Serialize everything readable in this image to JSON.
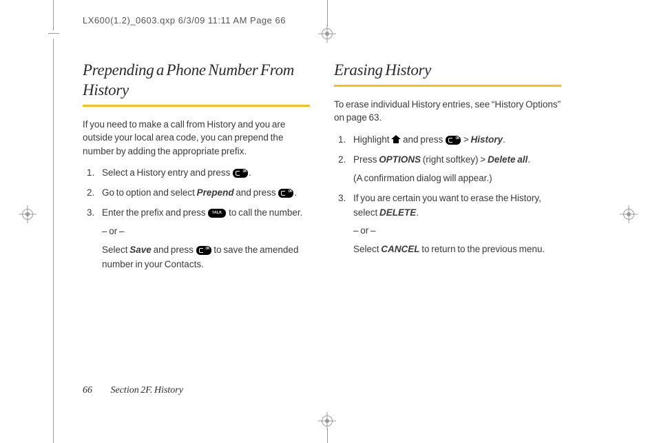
{
  "header_line": "LX600(1.2)_0603.qxp  6/3/09  11:11 AM  Page 66",
  "left": {
    "title": "Prepending a Phone Number From History",
    "intro": "If you need to make a call from History and you are outside your local area code, you can prepend the number by adding the appropriate prefix.",
    "step1_a": "Select a History entry and press ",
    "step1_b": ".",
    "step2_a": "Go to option and select ",
    "step2_prepend": "Prepend",
    "step2_b": " and press ",
    "step2_c": ".",
    "step3_a": "Enter the prefix and press ",
    "step3_b": " to call the number.",
    "or": "– or –",
    "step3_c": "Select ",
    "step3_save": "Save",
    "step3_d": " and press ",
    "step3_e": " to save the amended number in your Contacts."
  },
  "right": {
    "title": "Erasing History",
    "intro": "To erase individual History entries, see “History Options” on page 63.",
    "r1_a": "Highlight ",
    "r1_b": " and press ",
    "r1_c": " > ",
    "r1_history": "History",
    "r1_d": ".",
    "r2_a": "Press ",
    "r2_options": "OPTIONS",
    "r2_b": " (right softkey) > ",
    "r2_delall": "Delete all",
    "r2_c": ".",
    "r2_d": "(A confirmation dialog will appear.)",
    "r3_a": "If you are certain you want to erase the History, select ",
    "r3_delete": "DELETE",
    "r3_b": ".",
    "or": "– or –",
    "r3_c": "Select ",
    "r3_cancel": "CANCEL",
    "r3_d": " to return to the previous menu."
  },
  "footer": {
    "page": "66",
    "section": "Section 2F. History"
  }
}
